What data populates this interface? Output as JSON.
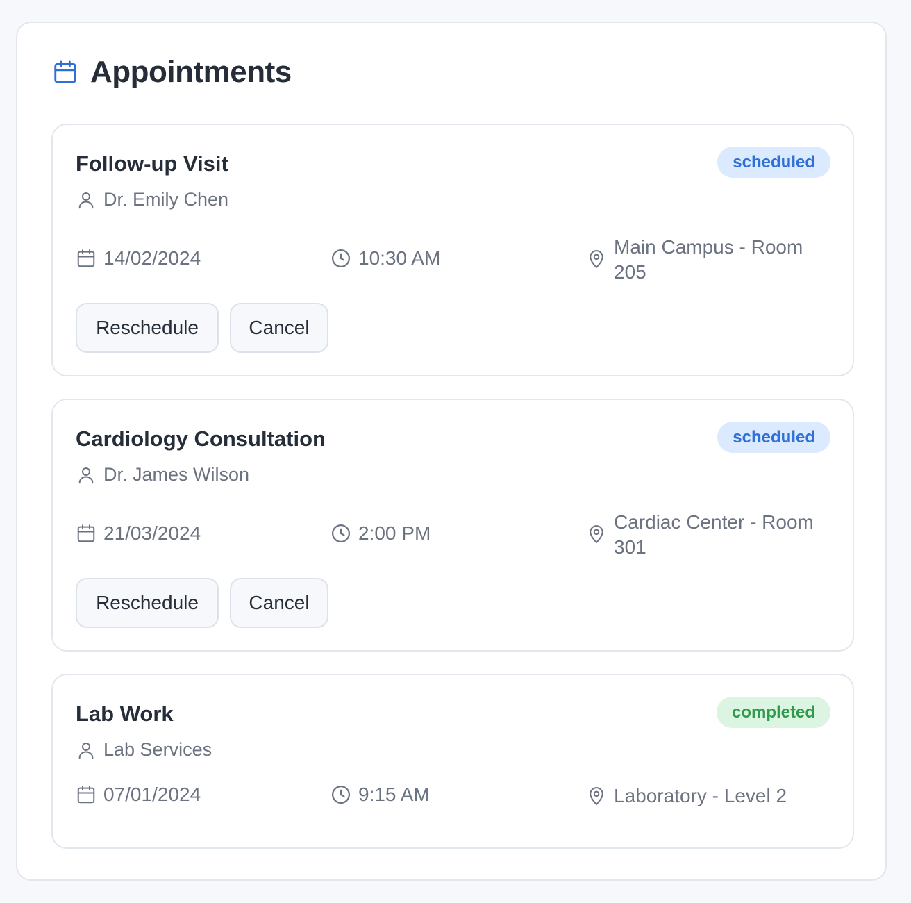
{
  "header": {
    "title": "Appointments",
    "icon": "calendar-icon",
    "accent_color": "#2f6fd6"
  },
  "appointments": [
    {
      "title": "Follow-up Visit",
      "provider": "Dr. Emily Chen",
      "date": "14/02/2024",
      "time": "10:30 AM",
      "location": "Main Campus - Room 205",
      "status": "scheduled",
      "actions": {
        "reschedule": "Reschedule",
        "cancel": "Cancel"
      }
    },
    {
      "title": "Cardiology Consultation",
      "provider": "Dr. James Wilson",
      "date": "21/03/2024",
      "time": "2:00 PM",
      "location": "Cardiac Center - Room 301",
      "status": "scheduled",
      "actions": {
        "reschedule": "Reschedule",
        "cancel": "Cancel"
      }
    },
    {
      "title": "Lab Work",
      "provider": "Lab Services",
      "date": "07/01/2024",
      "time": "9:15 AM",
      "location": "Laboratory - Level 2",
      "status": "completed"
    }
  ],
  "status_colors": {
    "scheduled": {
      "bg": "#dbeafe",
      "fg": "#2f6fd6"
    },
    "completed": {
      "bg": "#dcf5e3",
      "fg": "#2e9a4a"
    }
  },
  "icons": {
    "provider": "user-icon",
    "date": "calendar-icon",
    "time": "clock-icon",
    "location": "map-pin-icon"
  }
}
